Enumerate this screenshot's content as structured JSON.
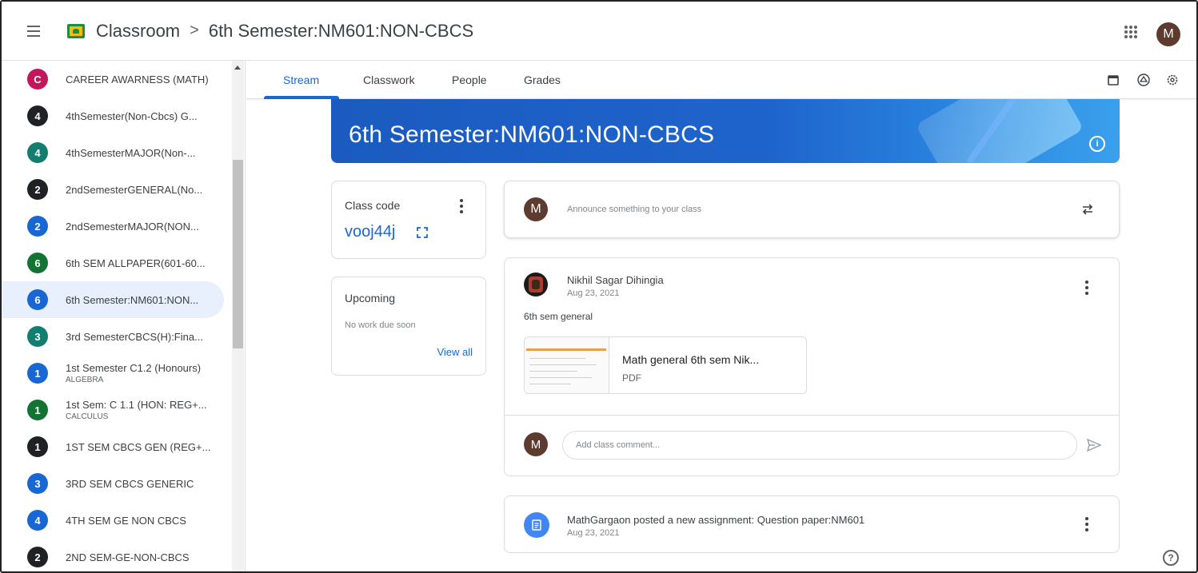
{
  "header": {
    "app_name": "Classroom",
    "separator": ">",
    "class_name": "6th Semester:NM601:NON-CBCS",
    "user_initial": "M"
  },
  "sidebar": {
    "items": [
      {
        "initial": "C",
        "label": "CAREER AWARNESS (MATH)",
        "sub": "",
        "color": "#c2185b",
        "active": false
      },
      {
        "initial": "4",
        "label": "4thSemester(Non-Cbcs) G...",
        "sub": "",
        "color": "#202124",
        "active": false
      },
      {
        "initial": "4",
        "label": "4thSemesterMAJOR(Non-...",
        "sub": "",
        "color": "#137e6f",
        "active": false
      },
      {
        "initial": "2",
        "label": "2ndSemesterGENERAL(No...",
        "sub": "",
        "color": "#202124",
        "active": false
      },
      {
        "initial": "2",
        "label": "2ndSemesterMAJOR(NON...",
        "sub": "",
        "color": "#1967d2",
        "active": false
      },
      {
        "initial": "6",
        "label": "6th SEM ALLPAPER(601-60...",
        "sub": "",
        "color": "#137333",
        "active": false
      },
      {
        "initial": "6",
        "label": "6th Semester:NM601:NON...",
        "sub": "",
        "color": "#1967d2",
        "active": true
      },
      {
        "initial": "3",
        "label": "3rd SemesterCBCS(H):Fina...",
        "sub": "",
        "color": "#137e6f",
        "active": false
      },
      {
        "initial": "1",
        "label": "1st Semester C1.2 (Honours)",
        "sub": "ALGEBRA",
        "color": "#1967d2",
        "active": false
      },
      {
        "initial": "1",
        "label": "1st Sem: C 1.1 (HON: REG+...",
        "sub": "CALCULUS",
        "color": "#137333",
        "active": false
      },
      {
        "initial": "1",
        "label": "1ST SEM CBCS GEN (REG+...",
        "sub": "",
        "color": "#202124",
        "active": false
      },
      {
        "initial": "3",
        "label": "3RD SEM CBCS GENERIC",
        "sub": "",
        "color": "#1967d2",
        "active": false
      },
      {
        "initial": "4",
        "label": "4TH SEM GE NON CBCS",
        "sub": "",
        "color": "#1967d2",
        "active": false
      },
      {
        "initial": "2",
        "label": "2ND SEM-GE-NON-CBCS",
        "sub": "",
        "color": "#202124",
        "active": false
      }
    ]
  },
  "tabs": [
    {
      "label": "Stream",
      "active": true
    },
    {
      "label": "Classwork",
      "active": false
    },
    {
      "label": "People",
      "active": false
    },
    {
      "label": "Grades",
      "active": false
    }
  ],
  "banner": {
    "title": "6th Semester:NM601:NON-CBCS",
    "info_icon": "i"
  },
  "class_code": {
    "title": "Class code",
    "value": "vooj44j"
  },
  "upcoming": {
    "title": "Upcoming",
    "empty_text": "No work due soon",
    "view_all": "View all"
  },
  "announce": {
    "avatar_initial": "M",
    "placeholder": "Announce something to your class"
  },
  "post": {
    "author": "Nikhil Sagar Dihingia",
    "date": "Aug 23, 2021",
    "body": "6th sem general",
    "attachment_title": "Math general 6th sem Nik...",
    "attachment_type": "PDF",
    "comment_avatar": "M",
    "comment_placeholder": "Add class comment..."
  },
  "assignment": {
    "text": "MathGargaon posted a new assignment: Question paper:NM601",
    "date": "Aug 23, 2021"
  },
  "help": "?",
  "colors": {
    "accent": "#1967d2",
    "banner": "#1e63cc",
    "avatar": "#5d3b2e"
  }
}
